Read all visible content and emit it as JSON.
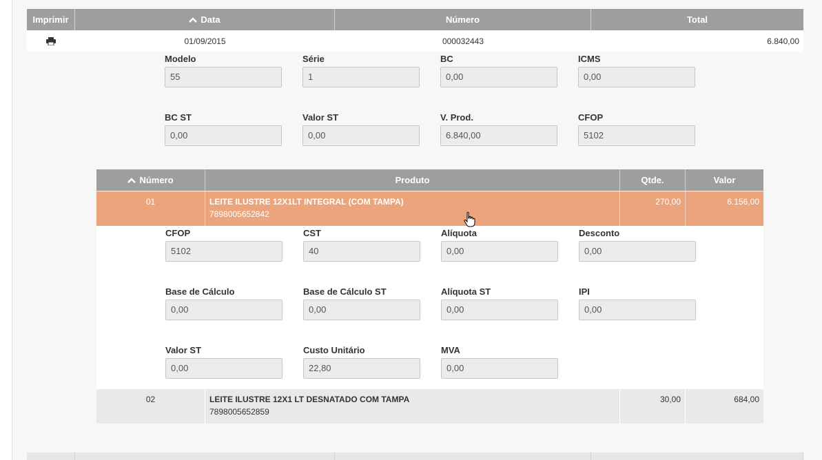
{
  "outer_table": {
    "headers": {
      "imprimir": "Imprimir",
      "data": "Data",
      "numero": "Número",
      "total": "Total"
    },
    "row": {
      "data": "01/09/2015",
      "numero": "000032443",
      "total": "6.840,00"
    }
  },
  "nota": {
    "modelo": {
      "label": "Modelo",
      "value": "55"
    },
    "serie": {
      "label": "Série",
      "value": "1"
    },
    "bc": {
      "label": "BC",
      "value": "0,00"
    },
    "icms": {
      "label": "ICMS",
      "value": "0,00"
    },
    "bc_st": {
      "label": "BC ST",
      "value": "0,00"
    },
    "valor_st": {
      "label": "Valor ST",
      "value": "0,00"
    },
    "v_prod": {
      "label": "V. Prod.",
      "value": "6.840,00"
    },
    "cfop": {
      "label": "CFOP",
      "value": "5102"
    }
  },
  "items_table": {
    "headers": {
      "numero": "Número",
      "produto": "Produto",
      "qtde": "Qtde.",
      "valor": "Valor"
    },
    "items": [
      {
        "numero": "01",
        "produto": "LEITE ILUSTRE 12X1LT INTEGRAL (COM TAMPA)",
        "codigo": "7898005652842",
        "qtde": "270,00",
        "valor": "6.156,00"
      },
      {
        "numero": "02",
        "produto": "LEITE ILUSTRE 12X1 LT DESNATADO COM TAMPA",
        "codigo": "7898005652859",
        "qtde": "30,00",
        "valor": "684,00"
      }
    ]
  },
  "item_detail": {
    "cfop": {
      "label": "CFOP",
      "value": "5102"
    },
    "cst": {
      "label": "CST",
      "value": "40"
    },
    "aliquota": {
      "label": "Alíquota",
      "value": "0,00"
    },
    "desconto": {
      "label": "Desconto",
      "value": "0,00"
    },
    "base_calculo": {
      "label": "Base de Cálculo",
      "value": "0,00"
    },
    "base_calculo_st": {
      "label": "Base de Cálculo ST",
      "value": "0,00"
    },
    "aliquota_st": {
      "label": "Alíquota ST",
      "value": "0,00"
    },
    "ipi": {
      "label": "IPI",
      "value": "0,00"
    },
    "valor_st": {
      "label": "Valor ST",
      "value": "0,00"
    },
    "custo_unitario": {
      "label": "Custo Unitário",
      "value": "22,80"
    },
    "mva": {
      "label": "MVA",
      "value": "0,00"
    }
  },
  "colors": {
    "header_bg": "#9e9e9e",
    "selected_row": "#eba47b",
    "row_alt": "#e9e9e9"
  }
}
